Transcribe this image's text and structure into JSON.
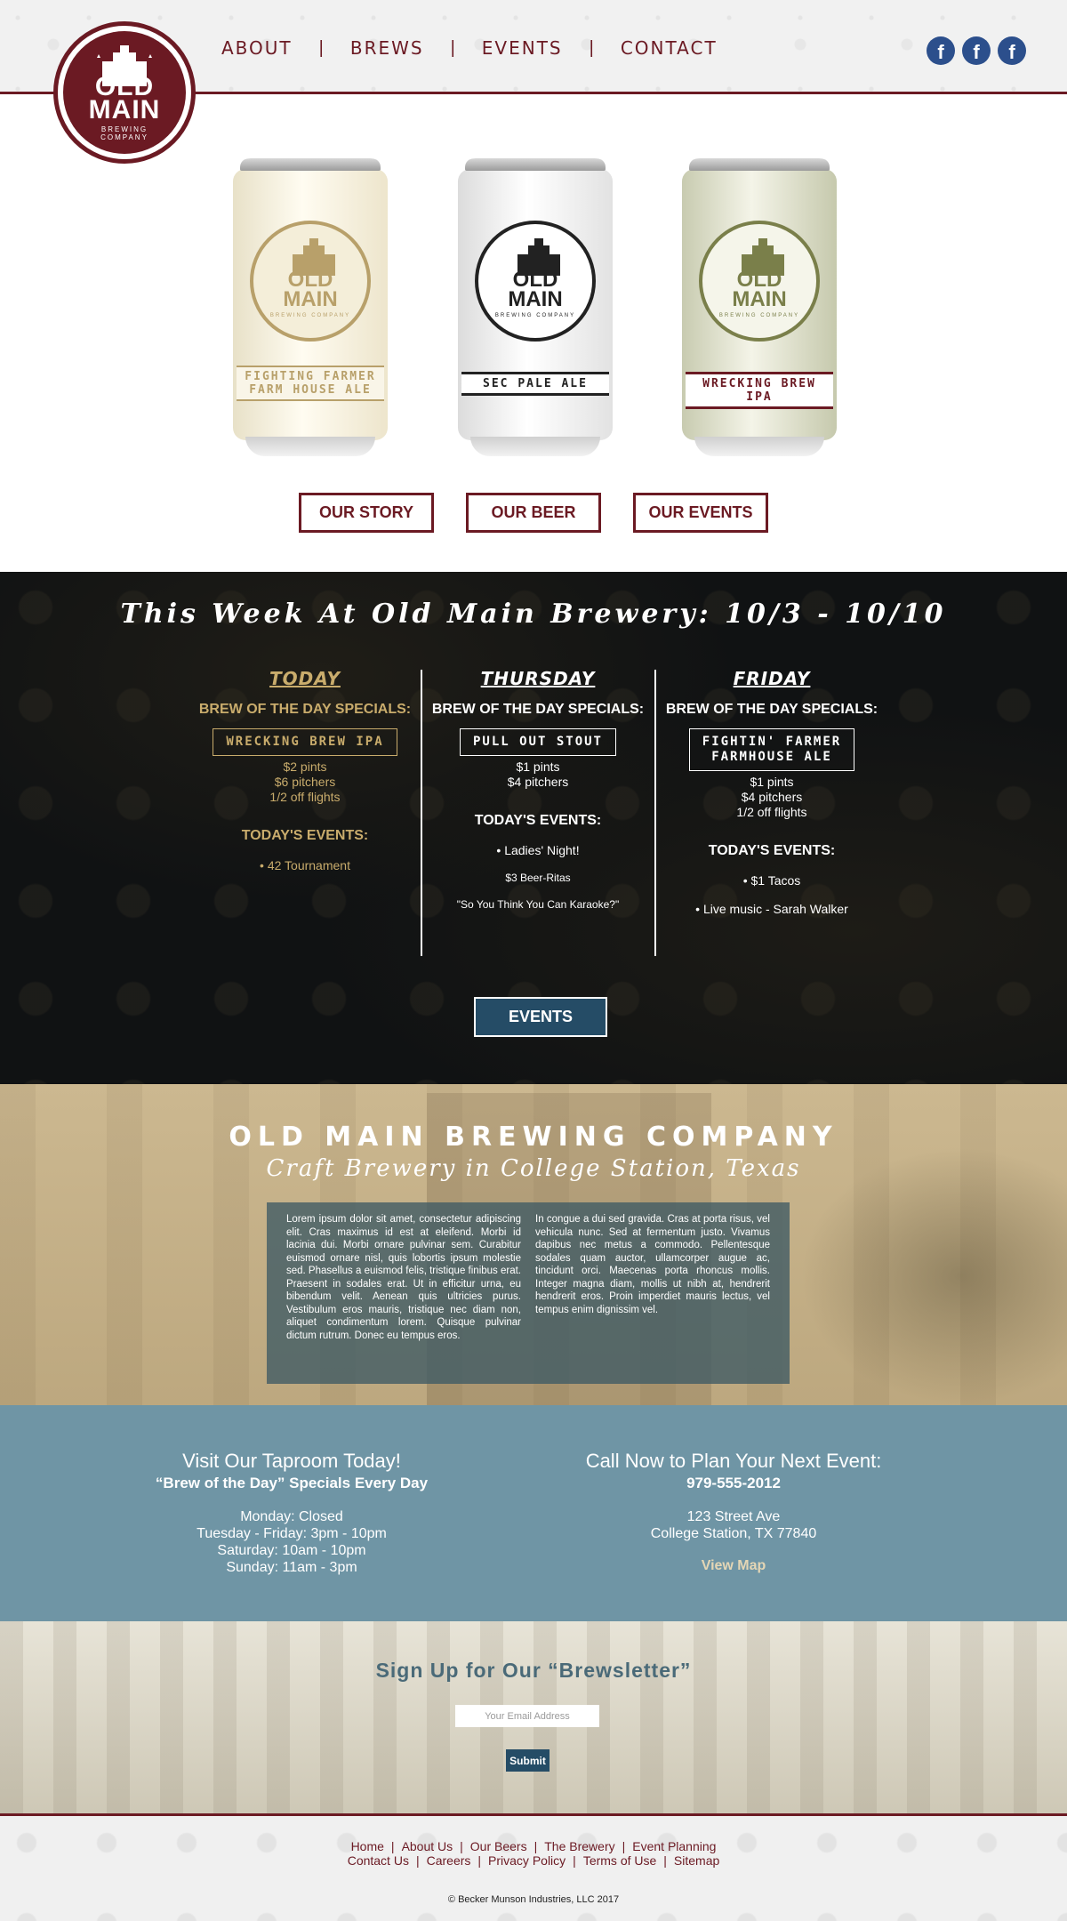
{
  "header": {
    "logo": {
      "line1": "OLD",
      "line2": "MAIN",
      "line3": "BREWING",
      "line4": "COMPANY"
    },
    "nav": [
      {
        "label": "ABOUT"
      },
      {
        "label": "BREWS"
      },
      {
        "label": "EVENTS"
      },
      {
        "label": "CONTACT"
      }
    ],
    "nav_separator": "|",
    "social": [
      {
        "icon": "facebook-icon",
        "glyph": "f"
      },
      {
        "icon": "facebook-icon",
        "glyph": "f"
      },
      {
        "icon": "facebook-icon",
        "glyph": "f"
      }
    ]
  },
  "cans": [
    {
      "badge1": "OLD",
      "badge2": "MAIN",
      "badge3": "BREWING COMPANY",
      "label": "FIGHTING FARMER\nFARM HOUSE ALE"
    },
    {
      "badge1": "OLD",
      "badge2": "MAIN",
      "badge3": "BREWING COMPANY",
      "label": "SEC PALE ALE"
    },
    {
      "badge1": "OLD",
      "badge2": "MAIN",
      "badge3": "BREWING COMPANY",
      "label": "WRECKING BREW IPA"
    }
  ],
  "hero_buttons": {
    "story": "OUR STORY",
    "beer": "OUR BEER",
    "events": "OUR EVENTS"
  },
  "week": {
    "title": "This Week At Old Main Brewery: 10/3 - 10/10",
    "columns": [
      {
        "heading": "TODAY",
        "special_label": "BREW OF THE DAY SPECIALS:",
        "beer": "WRECKING BREW IPA",
        "prices": [
          "$2 pints",
          "$6 pitchers",
          "1/2 off flights"
        ],
        "events_label": "TODAY'S EVENTS:",
        "events": [
          "• 42 Tournament"
        ]
      },
      {
        "heading": "THURSDAY",
        "special_label": "BREW OF THE DAY SPECIALS:",
        "beer": "PULL OUT STOUT",
        "prices": [
          "$1 pints",
          "$4 pitchers"
        ],
        "events_label": "TODAY'S EVENTS:",
        "events": [
          "• Ladies' Night!",
          "$3 Beer-Ritas",
          "\"So You Think You Can Karaoke?\""
        ]
      },
      {
        "heading": "FRIDAY",
        "special_label": "BREW OF THE DAY SPECIALS:",
        "beer": "FIGHTIN' FARMER\nFARMHOUSE ALE",
        "prices": [
          "$1 pints",
          "$4 pitchers",
          "1/2 off flights"
        ],
        "events_label": "TODAY'S EVENTS:",
        "events": [
          "• $1 Tacos",
          "• Live music - Sarah Walker"
        ]
      }
    ],
    "events_button": "EVENTS"
  },
  "company": {
    "title": "OLD MAIN BREWING COMPANY",
    "subtitle": "Craft Brewery in College Station, Texas",
    "text_left": "Lorem ipsum dolor sit amet, consectetur adipiscing elit. Cras maximus id est at eleifend. Morbi id lacinia dui. Morbi ornare pulvinar sem. Curabitur euismod ornare nisl, quis lobortis ipsum molestie sed. Phasellus a euismod felis, tristique finibus erat. Praesent in sodales erat. Ut in efficitur urna, eu bibendum velit. Aenean quis ultricies purus. Vestibulum eros mauris, tristique nec diam non, aliquet condimentum lorem. Quisque pulvinar dictum rutrum. Donec eu tempus eros.",
    "text_right": "In congue a dui sed gravida. Cras at porta risus, vel vehicula nunc. Sed at fermentum justo. Vivamus dapibus nec metus a commodo. Pellentesque sodales quam auctor, ullamcorper augue ac, tincidunt orci. Maecenas porta rhoncus mollis. Integer magna diam, mollis ut nibh at, hendrerit hendrerit eros. Proin imperdiet mauris lectus, vel tempus enim dignissim vel."
  },
  "info": {
    "taproom_title": "Visit Our Taproom Today!",
    "taproom_sub": "“Brew of the Day” Specials Every Day",
    "hours": [
      "Monday: Closed",
      "Tuesday - Friday: 3pm - 10pm",
      "Saturday: 10am - 10pm",
      "Sunday: 11am - 3pm"
    ],
    "event_title": "Call Now to Plan Your Next Event:",
    "phone": "979-555-2012",
    "address": [
      "123 Street Ave",
      "College Station, TX 77840"
    ],
    "map_link": "View Map"
  },
  "newsletter": {
    "title": "Sign Up for Our “Brewsletter”",
    "placeholder": "Your Email Address",
    "submit": "Submit"
  },
  "footer": {
    "links_row1": [
      "Home",
      "About Us",
      "Our Beers",
      "The Brewery",
      "Event Planning"
    ],
    "links_row2": [
      "Contact Us",
      "Careers",
      "Privacy Policy",
      "Terms of Use",
      "Sitemap"
    ],
    "separator": "|",
    "copyright": "© Becker Munson Industries, LLC 2017"
  },
  "colors": {
    "brand_maroon": "#6b1a23",
    "gold": "#c9ac6c",
    "dark_blue": "#254c66",
    "slate_blue": "#6f95a5",
    "facebook_blue": "#2c4f8c"
  }
}
